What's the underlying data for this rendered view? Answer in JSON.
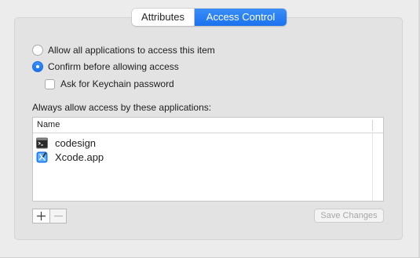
{
  "tabs": [
    {
      "label": "Attributes",
      "selected": false
    },
    {
      "label": "Access Control",
      "selected": true
    }
  ],
  "access": {
    "allow_all_label": "Allow all applications to access this item",
    "allow_all_selected": false,
    "confirm_label": "Confirm before allowing access",
    "confirm_selected": true,
    "keychain_password_label": "Ask for Keychain password",
    "keychain_password_checked": false
  },
  "apps_list": {
    "caption": "Always allow access by these applications:",
    "column_header": "Name",
    "items": [
      {
        "name": "codesign",
        "icon": "terminal-icon"
      },
      {
        "name": "Xcode.app",
        "icon": "xcode-icon"
      }
    ]
  },
  "buttons": {
    "add_icon": "plus-icon",
    "remove_icon": "minus-icon",
    "save_label": "Save Changes",
    "save_enabled": false
  },
  "colors": {
    "accent": "#1a72ee",
    "panel": "#e3e3e3",
    "window": "#ececec"
  }
}
